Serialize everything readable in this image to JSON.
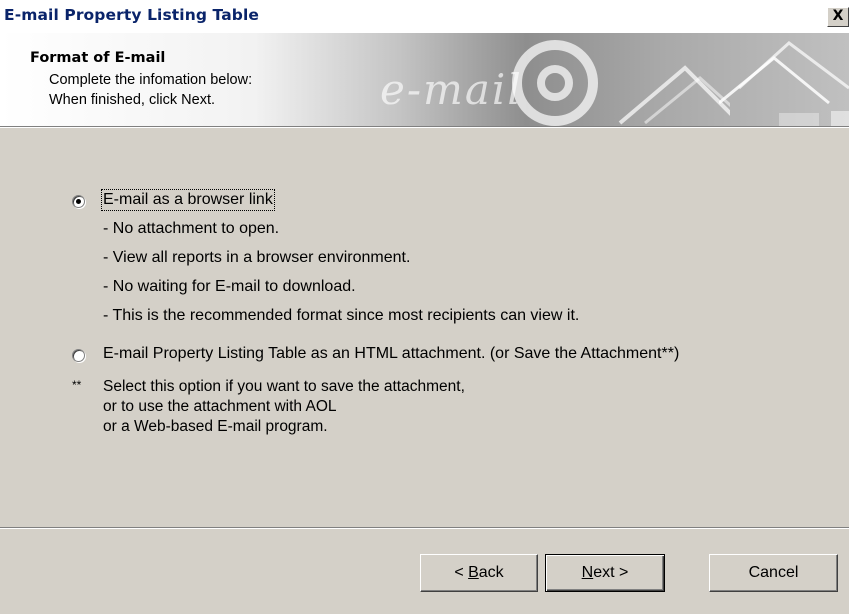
{
  "window": {
    "title": "E-mail Property Listing Table",
    "close_label": "X"
  },
  "header": {
    "title": "Format of E-mail",
    "subtitle_line1": "Complete the infomation below:",
    "subtitle_line2": "When finished, click Next.",
    "watermark": "e-mail"
  },
  "options": [
    {
      "label": "E-mail as a browser link",
      "selected": true,
      "bullets": [
        "- No attachment to open.",
        "- View all reports in a browser environment.",
        "- No waiting for E-mail to download.",
        "- This is the recommended format since most recipients can view it."
      ]
    },
    {
      "label": "E-mail Property Listing Table as an HTML attachment. (or Save the Attachment**)",
      "selected": false
    }
  ],
  "note": {
    "marker": "**",
    "lines": [
      "Select this option if you want to save the attachment,",
      "or to use the attachment with AOL",
      "or a Web-based E-mail program."
    ]
  },
  "buttons": {
    "back_prefix": "< ",
    "back_mnemonic": "B",
    "back_rest": "ack",
    "next_mnemonic": "N",
    "next_rest": "ext >",
    "cancel": "Cancel"
  },
  "colors": {
    "title_text": "#0a246a",
    "dialog_bg": "#d4d0c8"
  }
}
